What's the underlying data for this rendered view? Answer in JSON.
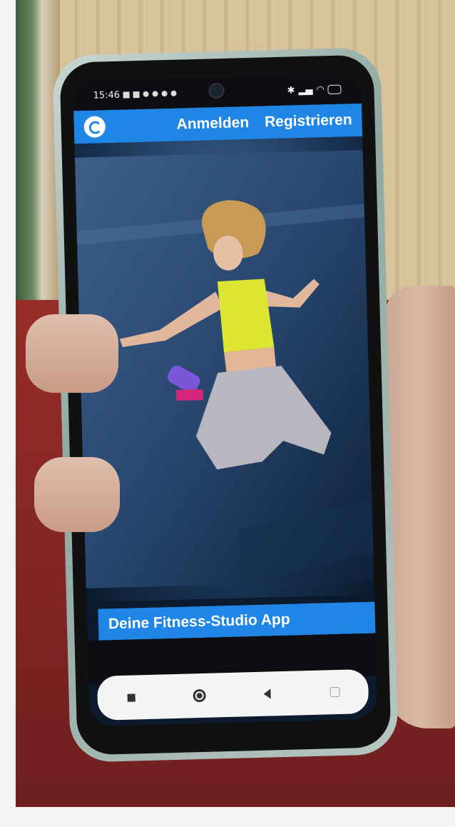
{
  "statusbar": {
    "time": "15:46"
  },
  "appbar": {
    "logo_icon": "app-logo-icon",
    "login_label": "Anmelden",
    "register_label": "Registrieren"
  },
  "caption": {
    "text": "Deine Fitness-Studio App"
  },
  "navbar": {
    "recents_icon": "square-icon",
    "home_icon": "circle-icon",
    "back_icon": "triangle-back-icon"
  },
  "colors": {
    "accent": "#1f86e6",
    "navbar_bg": "#f5f5f5"
  }
}
